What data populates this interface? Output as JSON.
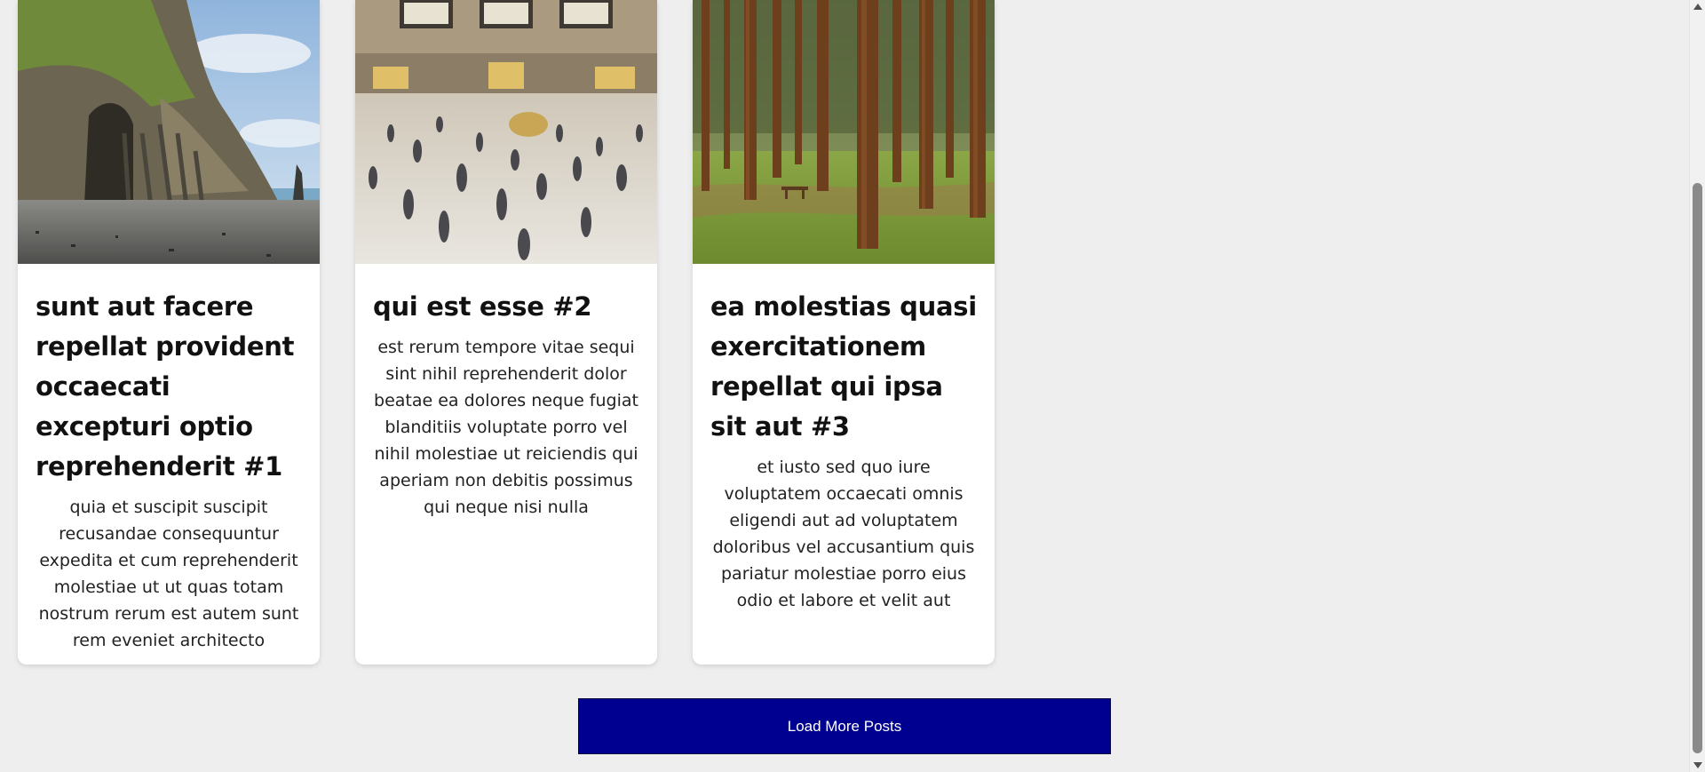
{
  "posts": [
    {
      "title": "sunt aut facere repellat provident occaecati excepturi optio reprehenderit #1",
      "body": "quia et suscipit suscipit recusandae consequuntur expedita et cum reprehenderit molestiae ut ut quas totam nostrum rerum est autem sunt rem eveniet architecto",
      "image": "coastal-cliff-beach-photo"
    },
    {
      "title": "qui est esse #2",
      "body": "est rerum tempore vitae sequi sint nihil reprehenderit dolor beatae ea dolores neque fugiat blanditiis voluptate porro vel nihil molestiae ut reiciendis qui aperiam non debitis possimus qui neque nisi nulla",
      "image": "busy-train-station-hall-photo"
    },
    {
      "title": "ea molestias quasi exercitationem repellat qui ipsa sit aut #3",
      "body": "et iusto sed quo iure voluptatem occaecati omnis eligendi aut ad voluptatem doloribus vel accusantium quis pariatur molestiae porro eius odio et labore et velit aut",
      "image": "pine-forest-photo"
    }
  ],
  "load_more_label": "Load More Posts",
  "colors": {
    "page_background": "#eeeeee",
    "button_background": "#000090",
    "card_background": "#ffffff"
  }
}
